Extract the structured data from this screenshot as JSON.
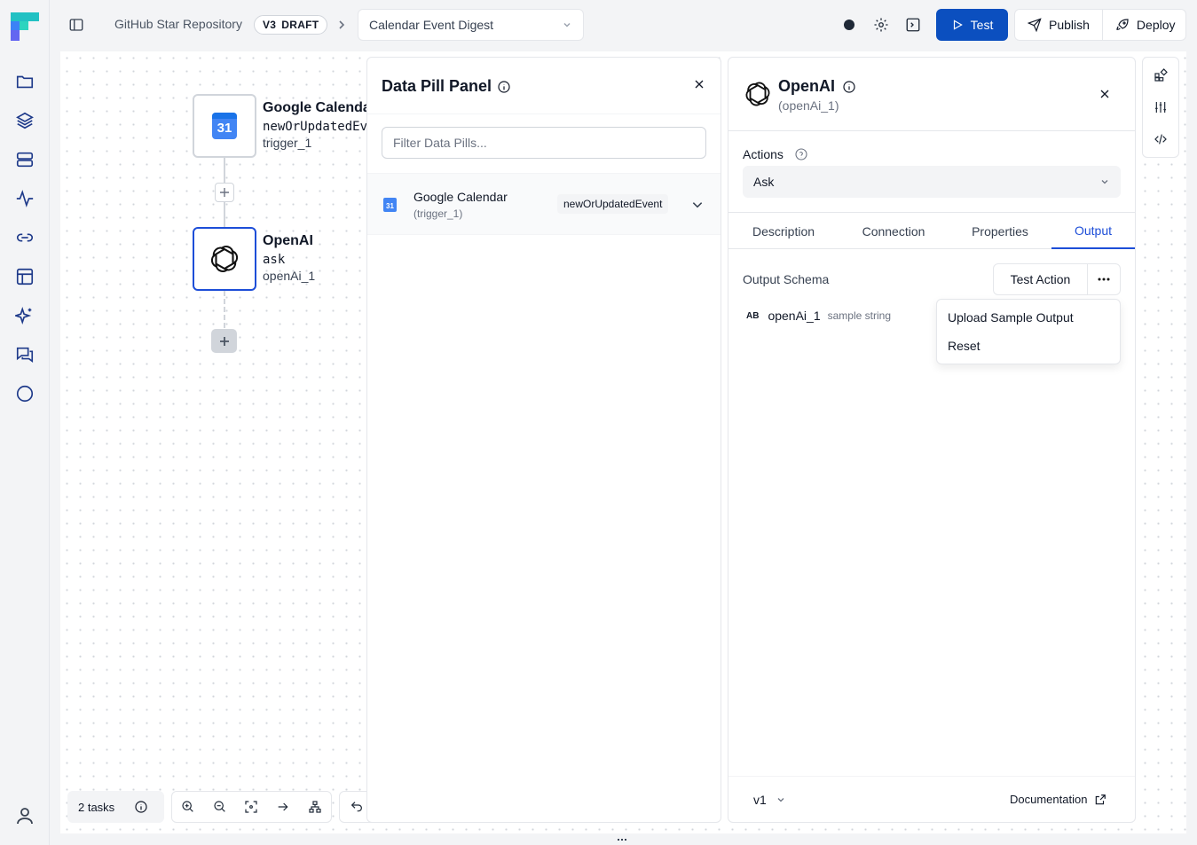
{
  "breadcrumb": {
    "project": "GitHub Star Repository",
    "version": "V3",
    "status": "DRAFT",
    "workflow": "Calendar Event Digest"
  },
  "toolbar": {
    "test_label": "Test",
    "publish_label": "Publish",
    "deploy_label": "Deploy"
  },
  "sidebar": {
    "items": [
      "folder-icon",
      "layers-icon",
      "server-icon",
      "activity-icon",
      "link-icon",
      "table-icon",
      "sparkles-icon",
      "chat-icon",
      "circle-icon"
    ],
    "bottom": "user-icon"
  },
  "nodes": [
    {
      "title": "Google Calendar",
      "operation": "newOrUpdatedEvent",
      "name": "trigger_1",
      "icon_text": "31"
    },
    {
      "title": "OpenAI",
      "operation": "ask",
      "name": "openAi_1"
    }
  ],
  "canvas_controls": {
    "tasks_label": "2 tasks"
  },
  "data_pill_panel": {
    "title": "Data Pill Panel",
    "filter_placeholder": "Filter Data Pills...",
    "items": [
      {
        "name": "Google Calendar",
        "ref": "(trigger_1)",
        "pill": "newOrUpdatedEvent",
        "icon_text": "31"
      }
    ]
  },
  "openai_panel": {
    "title": "OpenAI",
    "subtitle": "(openAi_1)",
    "actions_label": "Actions",
    "action_value": "Ask",
    "tabs": [
      "Description",
      "Connection",
      "Properties",
      "Output"
    ],
    "active_tab": "Output",
    "output_schema_label": "Output Schema",
    "test_action_label": "Test Action",
    "schema_type": "AB",
    "schema_field": "openAi_1",
    "schema_sample": "sample string",
    "menu_items": [
      "Upload Sample Output",
      "Reset"
    ],
    "version": "v1",
    "documentation_label": "Documentation"
  },
  "colors": {
    "accent": "#0b4fbf",
    "selected_border": "#1d4ed8",
    "calendar_blue": "#4285f4"
  }
}
